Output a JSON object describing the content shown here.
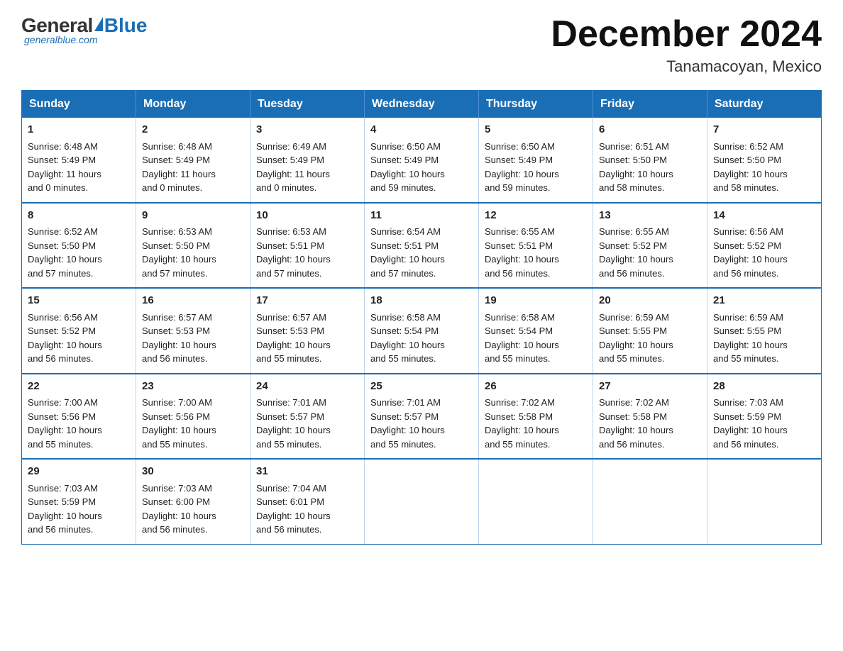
{
  "logo": {
    "general": "General",
    "blue": "Blue",
    "sub": "generalblue.com"
  },
  "title": {
    "month": "December 2024",
    "location": "Tanamacoyan, Mexico"
  },
  "headers": [
    "Sunday",
    "Monday",
    "Tuesday",
    "Wednesday",
    "Thursday",
    "Friday",
    "Saturday"
  ],
  "weeks": [
    [
      {
        "day": "1",
        "info": "Sunrise: 6:48 AM\nSunset: 5:49 PM\nDaylight: 11 hours\nand 0 minutes."
      },
      {
        "day": "2",
        "info": "Sunrise: 6:48 AM\nSunset: 5:49 PM\nDaylight: 11 hours\nand 0 minutes."
      },
      {
        "day": "3",
        "info": "Sunrise: 6:49 AM\nSunset: 5:49 PM\nDaylight: 11 hours\nand 0 minutes."
      },
      {
        "day": "4",
        "info": "Sunrise: 6:50 AM\nSunset: 5:49 PM\nDaylight: 10 hours\nand 59 minutes."
      },
      {
        "day": "5",
        "info": "Sunrise: 6:50 AM\nSunset: 5:49 PM\nDaylight: 10 hours\nand 59 minutes."
      },
      {
        "day": "6",
        "info": "Sunrise: 6:51 AM\nSunset: 5:50 PM\nDaylight: 10 hours\nand 58 minutes."
      },
      {
        "day": "7",
        "info": "Sunrise: 6:52 AM\nSunset: 5:50 PM\nDaylight: 10 hours\nand 58 minutes."
      }
    ],
    [
      {
        "day": "8",
        "info": "Sunrise: 6:52 AM\nSunset: 5:50 PM\nDaylight: 10 hours\nand 57 minutes."
      },
      {
        "day": "9",
        "info": "Sunrise: 6:53 AM\nSunset: 5:50 PM\nDaylight: 10 hours\nand 57 minutes."
      },
      {
        "day": "10",
        "info": "Sunrise: 6:53 AM\nSunset: 5:51 PM\nDaylight: 10 hours\nand 57 minutes."
      },
      {
        "day": "11",
        "info": "Sunrise: 6:54 AM\nSunset: 5:51 PM\nDaylight: 10 hours\nand 57 minutes."
      },
      {
        "day": "12",
        "info": "Sunrise: 6:55 AM\nSunset: 5:51 PM\nDaylight: 10 hours\nand 56 minutes."
      },
      {
        "day": "13",
        "info": "Sunrise: 6:55 AM\nSunset: 5:52 PM\nDaylight: 10 hours\nand 56 minutes."
      },
      {
        "day": "14",
        "info": "Sunrise: 6:56 AM\nSunset: 5:52 PM\nDaylight: 10 hours\nand 56 minutes."
      }
    ],
    [
      {
        "day": "15",
        "info": "Sunrise: 6:56 AM\nSunset: 5:52 PM\nDaylight: 10 hours\nand 56 minutes."
      },
      {
        "day": "16",
        "info": "Sunrise: 6:57 AM\nSunset: 5:53 PM\nDaylight: 10 hours\nand 56 minutes."
      },
      {
        "day": "17",
        "info": "Sunrise: 6:57 AM\nSunset: 5:53 PM\nDaylight: 10 hours\nand 55 minutes."
      },
      {
        "day": "18",
        "info": "Sunrise: 6:58 AM\nSunset: 5:54 PM\nDaylight: 10 hours\nand 55 minutes."
      },
      {
        "day": "19",
        "info": "Sunrise: 6:58 AM\nSunset: 5:54 PM\nDaylight: 10 hours\nand 55 minutes."
      },
      {
        "day": "20",
        "info": "Sunrise: 6:59 AM\nSunset: 5:55 PM\nDaylight: 10 hours\nand 55 minutes."
      },
      {
        "day": "21",
        "info": "Sunrise: 6:59 AM\nSunset: 5:55 PM\nDaylight: 10 hours\nand 55 minutes."
      }
    ],
    [
      {
        "day": "22",
        "info": "Sunrise: 7:00 AM\nSunset: 5:56 PM\nDaylight: 10 hours\nand 55 minutes."
      },
      {
        "day": "23",
        "info": "Sunrise: 7:00 AM\nSunset: 5:56 PM\nDaylight: 10 hours\nand 55 minutes."
      },
      {
        "day": "24",
        "info": "Sunrise: 7:01 AM\nSunset: 5:57 PM\nDaylight: 10 hours\nand 55 minutes."
      },
      {
        "day": "25",
        "info": "Sunrise: 7:01 AM\nSunset: 5:57 PM\nDaylight: 10 hours\nand 55 minutes."
      },
      {
        "day": "26",
        "info": "Sunrise: 7:02 AM\nSunset: 5:58 PM\nDaylight: 10 hours\nand 55 minutes."
      },
      {
        "day": "27",
        "info": "Sunrise: 7:02 AM\nSunset: 5:58 PM\nDaylight: 10 hours\nand 56 minutes."
      },
      {
        "day": "28",
        "info": "Sunrise: 7:03 AM\nSunset: 5:59 PM\nDaylight: 10 hours\nand 56 minutes."
      }
    ],
    [
      {
        "day": "29",
        "info": "Sunrise: 7:03 AM\nSunset: 5:59 PM\nDaylight: 10 hours\nand 56 minutes."
      },
      {
        "day": "30",
        "info": "Sunrise: 7:03 AM\nSunset: 6:00 PM\nDaylight: 10 hours\nand 56 minutes."
      },
      {
        "day": "31",
        "info": "Sunrise: 7:04 AM\nSunset: 6:01 PM\nDaylight: 10 hours\nand 56 minutes."
      },
      {
        "day": "",
        "info": ""
      },
      {
        "day": "",
        "info": ""
      },
      {
        "day": "",
        "info": ""
      },
      {
        "day": "",
        "info": ""
      }
    ]
  ]
}
